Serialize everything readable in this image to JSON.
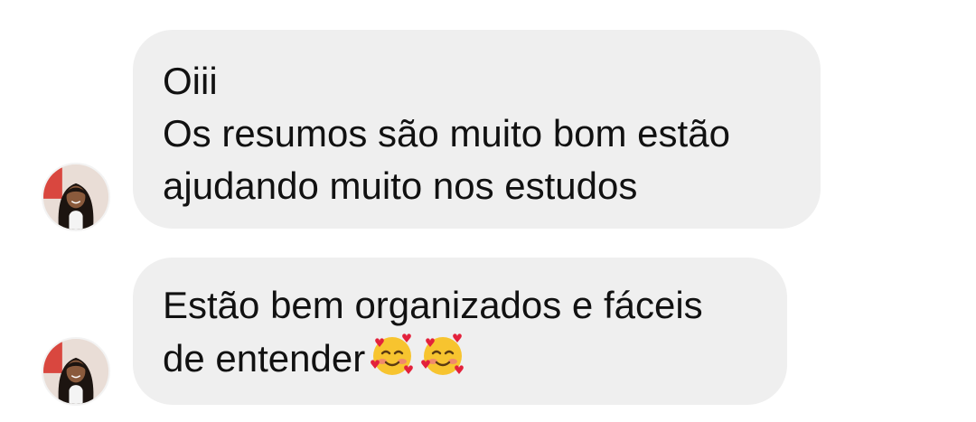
{
  "messages": [
    {
      "lines": [
        "Oiii",
        "Os resumos são muito bom estão",
        "ajudando muito nos estudos"
      ]
    },
    {
      "lines": [
        "Estão bem organizados e fáceis",
        "de entender"
      ],
      "emojis": [
        "smiling-face-with-hearts-icon",
        "smiling-face-with-hearts-icon"
      ]
    }
  ],
  "colors": {
    "bubble_bg": "#efefef",
    "text": "#111111",
    "background": "#ffffff"
  }
}
